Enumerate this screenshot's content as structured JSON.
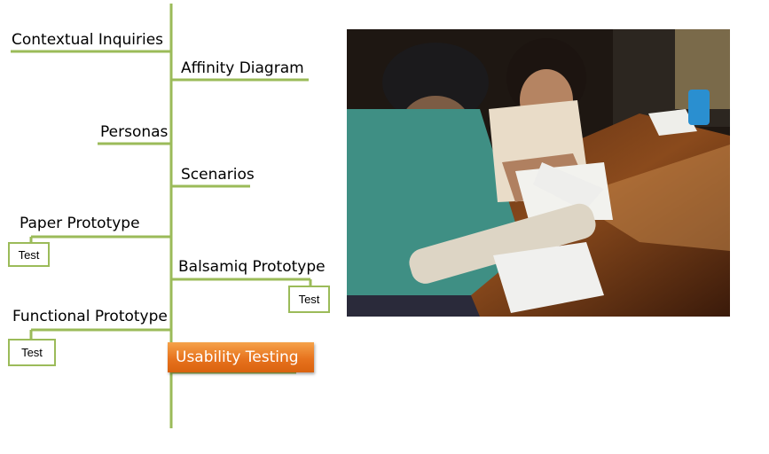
{
  "timeline": {
    "line_color": "#9bbb59",
    "steps": [
      {
        "label": "Contextual  Inquiries",
        "side": "left"
      },
      {
        "label": "Affinity Diagram",
        "side": "right"
      },
      {
        "label": "Personas",
        "side": "left"
      },
      {
        "label": "Scenarios",
        "side": "right"
      },
      {
        "label": "Paper Prototype",
        "side": "left",
        "test": "Test"
      },
      {
        "label": "Balsamiq Prototype",
        "side": "right",
        "test": "Test"
      },
      {
        "label": "Functional Prototype",
        "side": "left",
        "test": "Test"
      },
      {
        "label": "Usability Testing",
        "side": "right",
        "highlighted": true,
        "highlight_color": "#e7731e"
      }
    ]
  },
  "photo": {
    "description_icon": "photo-icon"
  }
}
